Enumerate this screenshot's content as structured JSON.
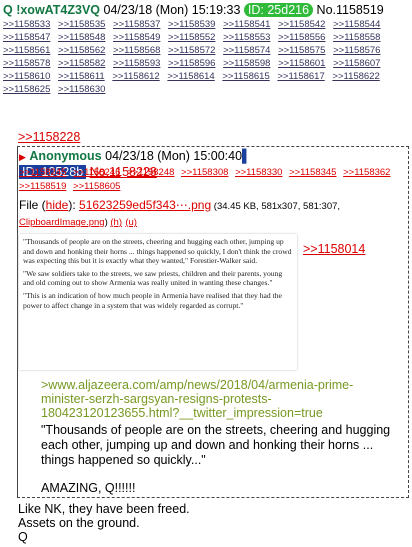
{
  "post": {
    "name_trip": "Q !xowAT4Z3VQ",
    "datetime": "04/23/18 (Mon) 15:19:33",
    "id_label": "ID: 25d216",
    "number": "No.1158519",
    "replies": [
      ">>1158533",
      ">>1158535",
      ">>1158537",
      ">>1158539",
      ">>1158541",
      ">>1158542",
      ">>1158544",
      ">>1158547",
      ">>1158548",
      ">>1158549",
      ">>1158552",
      ">>1158553",
      ">>1158556",
      ">>1158558",
      ">>1158561",
      ">>1158562",
      ">>1158568",
      ">>1158572",
      ">>1158574",
      ">>1158575",
      ">>1158576",
      ">>1158578",
      ">>1158582",
      ">>1158593",
      ">>1158596",
      ">>1158598",
      ">>1158601",
      ">>1158607",
      ">>1158610",
      ">>1158611",
      ">>1158612",
      ">>1158614",
      ">>1158615",
      ">>1158617",
      ">>1158622",
      ">>1158625",
      ">>1158630"
    ],
    "quote_link": ">>1158228",
    "footer_lines": [
      "Like NK, they have been freed.",
      "Assets on the ground.",
      "Q"
    ]
  },
  "quoted": {
    "name": "Anonymous",
    "datetime": "04/23/18 (Mon) 15:00:40",
    "id_label": "ID: 10528b",
    "number": "No.1158228",
    "replies": [
      ">>1158245",
      ">>1158246",
      ">>1158248",
      ">>1158308",
      ">>1158330",
      ">>1158345",
      ">>1158362",
      ">>1158519",
      ">>1158605"
    ],
    "file": {
      "prefix": "File (",
      "hide": "hide",
      "mid": "): ",
      "filename": "51623259ed5f343⋯.png",
      "meta": " (34.45 KB, 581x307, 581:307, ",
      "orig_name": "ClipboardImage.png",
      "close": ") ",
      "h": "(h)",
      "u": "(u)"
    },
    "thumb_paragraphs": [
      "\"Thousands of people are on the streets, cheering and hugging each other, jumping up and down and honking their horns ... things happened so quickly, I don't think the crowd was expecting this but it is exactly what they wanted,\" Forestier-Walker said.",
      "\"We saw soldiers take to the streets, we saw priests, children and their parents, young and old coming out to show Armenia was really united in wanting these changes.\"",
      "\"This is an indication of how much people in Armenia have realised that they had the power to affect change in a system that was widely regarded as corrupt.\""
    ],
    "side_link": ">>1158014",
    "greentext": ">www.aljazeera.com/amp/news/2018/04/armenia-prime-minister-serzh-sargsyan-resigns-protests-180423120123655.html?__twitter_impression=true",
    "body": "\"Thousands of people are on the streets, cheering and hugging each other, jumping up and down and honking their horns ... things happened so quickly...\"",
    "amazing": "AMAZING, Q!!!!!!"
  }
}
